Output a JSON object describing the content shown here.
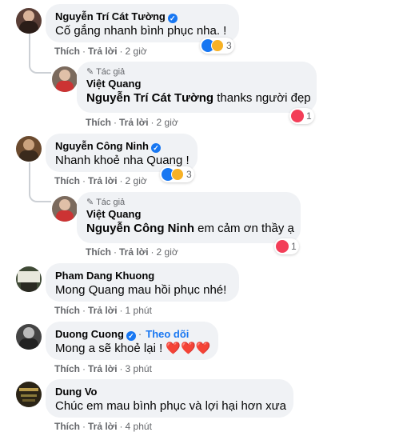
{
  "comments": [
    {
      "name": "Nguyễn Trí Cát Tường",
      "verified": true,
      "text": "Cố gắng nhanh bình phục nha. !",
      "like": "Thích",
      "reply": "Trả lời",
      "time": "2 giờ",
      "reactions": {
        "icons": [
          "like-icon",
          "care-icon"
        ],
        "count": "3"
      },
      "avatar_color": "#5a3e36"
    },
    {
      "author_tag": "Tác giả",
      "name": "Việt Quang",
      "mention": "Nguyễn Trí Cát Tường",
      "text": "thanks người đẹp",
      "like": "Thích",
      "reply": "Trả lời",
      "time": "2 giờ",
      "reactions": {
        "icons": [
          "heart-icon"
        ],
        "count": "1"
      },
      "avatar_color": "#7b6a5d"
    },
    {
      "name": "Nguyễn Công Ninh",
      "verified": true,
      "text": "Nhanh khoẻ nha Quang !",
      "like": "Thích",
      "reply": "Trả lời",
      "time": "2 giờ",
      "reactions": {
        "icons": [
          "like-icon",
          "care-icon"
        ],
        "count": "3"
      },
      "avatar_color": "#6b4a2e"
    },
    {
      "author_tag": "Tác giả",
      "name": "Việt Quang",
      "mention": "Nguyễn Công Ninh",
      "text": "em cảm ơn thầy ạ",
      "like": "Thích",
      "reply": "Trả lời",
      "time": "2 giờ",
      "reactions": {
        "icons": [
          "heart-icon"
        ],
        "count": "1"
      },
      "avatar_color": "#7b6a5d"
    },
    {
      "name": "Pham Dang Khuong",
      "text": "Mong Quang mau hồi phục nhé!",
      "like": "Thích",
      "reply": "Trả lời",
      "time": "1 phút",
      "avatar_color": "#3f4a36"
    },
    {
      "name": "Duong Cuong",
      "verified": true,
      "follow": "Theo dõi",
      "text": "Mong a sẽ khoẻ lại ! ❤️❤️❤️",
      "like": "Thích",
      "reply": "Trả lời",
      "time": "3 phút",
      "avatar_color": "#444444"
    },
    {
      "name": "Dung Vo",
      "text": "Chúc em mau bình phục và lợi hại hơn xưa",
      "like": "Thích",
      "reply": "Trả lời",
      "time": "4 phút",
      "avatar_color": "#2b2416"
    }
  ],
  "separator": "·",
  "colors": {
    "link": "#1877f2",
    "bubble": "#f0f2f5",
    "meta": "#65676b",
    "heart": "#f33e58"
  }
}
